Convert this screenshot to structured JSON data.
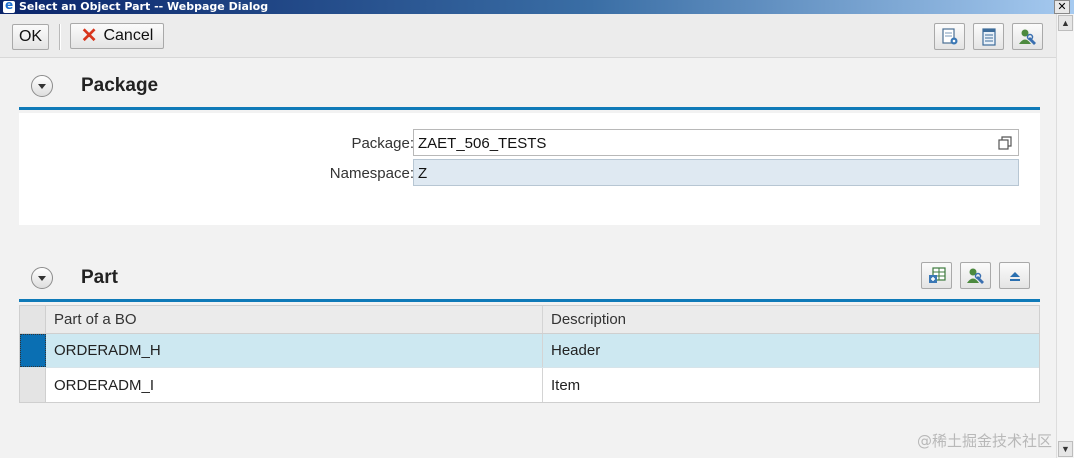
{
  "window": {
    "title": "Select an Object Part -- Webpage Dialog",
    "close_glyph": "✕"
  },
  "toolbar": {
    "ok_label": "OK",
    "cancel_label": "Cancel",
    "icons": [
      "settings-page-icon",
      "document-icon",
      "personalize-icon"
    ]
  },
  "package_section": {
    "title": "Package",
    "fields": {
      "package_label": "Package:",
      "package_value": "ZAET_506_TESTS",
      "namespace_label": "Namespace:",
      "namespace_value": "Z"
    }
  },
  "part_section": {
    "title": "Part",
    "icons": [
      "export-table-icon",
      "personalize-icon",
      "collapse-up-icon"
    ],
    "table": {
      "columns": [
        "Part of a BO",
        "Description"
      ],
      "rows": [
        {
          "part": "ORDERADM_H",
          "description": "Header",
          "selected": true
        },
        {
          "part": "ORDERADM_I",
          "description": "Item",
          "selected": false
        }
      ]
    }
  },
  "watermark": "@稀土掘金技术社区",
  "colors": {
    "accent": "#0f7ab8",
    "selected_row": "#cde8f1",
    "readonly_field": "#dfe9f2",
    "cancel_icon": "#d8351c"
  }
}
